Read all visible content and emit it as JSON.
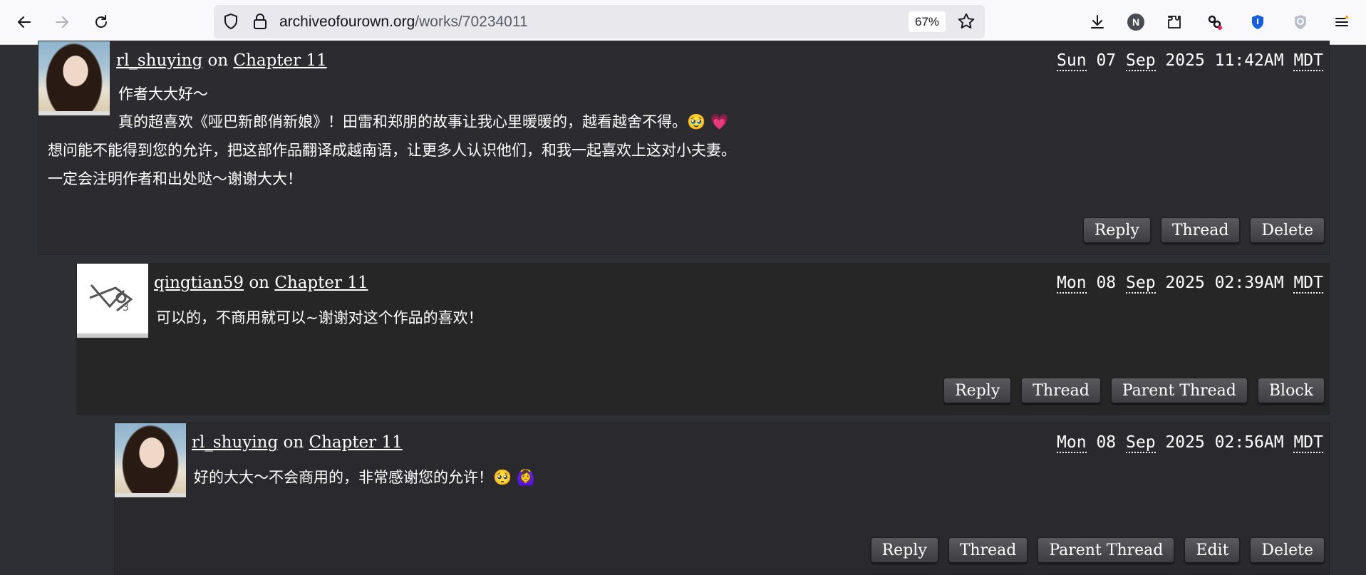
{
  "browser": {
    "url_domain": "archiveofourown.org",
    "url_path": "/works/70234011",
    "zoom": "67%",
    "profile_initial": "N"
  },
  "comments": [
    {
      "author": "rl_shuying",
      "on": "on",
      "chapter": "Chapter 11",
      "date": {
        "day": "Sun",
        "dd": "07",
        "mon": "Sep",
        "year": "2025",
        "time": "11:42AM",
        "tz": "MDT"
      },
      "lines": [
        "作者大大好～",
        "真的超喜欢《哑巴新郎俏新娘》！田雷和郑朋的故事让我心里暖暖的，越看越舍不得。🥹 💗",
        "想问能不能得到您的允许，把这部作品翻译成越南语，让更多人认识他们，和我一起喜欢上这对小夫妻。",
        "一定会注明作者和出处哒～谢谢大大！"
      ],
      "actions": [
        "Reply",
        "Thread",
        "Delete"
      ]
    },
    {
      "author": "qingtian59",
      "on": "on",
      "chapter": "Chapter 11",
      "date": {
        "day": "Mon",
        "dd": "08",
        "mon": "Sep",
        "year": "2025",
        "time": "02:39AM",
        "tz": "MDT"
      },
      "lines": [
        "可以的，不商用就可以~谢谢对这个作品的喜欢！"
      ],
      "actions": [
        "Reply",
        "Thread",
        "Parent Thread",
        "Block"
      ]
    },
    {
      "author": "rl_shuying",
      "on": "on",
      "chapter": "Chapter 11",
      "date": {
        "day": "Mon",
        "dd": "08",
        "mon": "Sep",
        "year": "2025",
        "time": "02:56AM",
        "tz": "MDT"
      },
      "lines": [
        "好的大大～不会商用的，非常感谢您的允许！🥺 🙆‍♀️"
      ],
      "actions": [
        "Reply",
        "Thread",
        "Parent Thread",
        "Edit",
        "Delete"
      ]
    }
  ]
}
